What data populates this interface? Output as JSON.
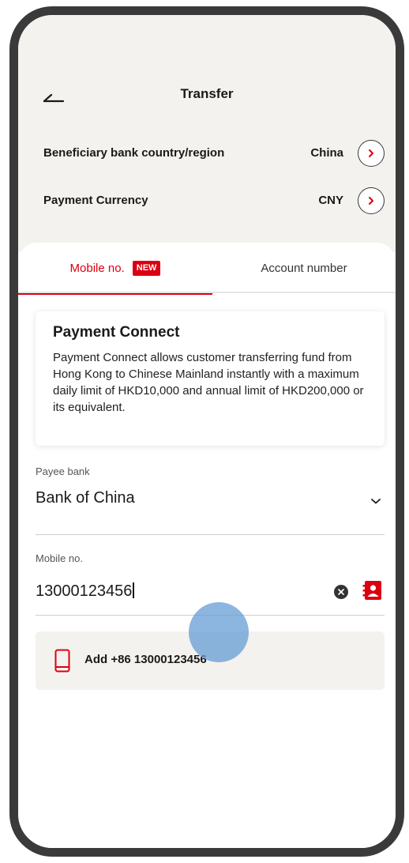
{
  "header": {
    "title": "Transfer"
  },
  "settings": [
    {
      "label": "Beneficiary bank country/region",
      "value": "China"
    },
    {
      "label": "Payment Currency",
      "value": "CNY"
    }
  ],
  "tabs": [
    {
      "label": "Mobile no.",
      "badge": "NEW",
      "active": true
    },
    {
      "label": "Account number",
      "active": false
    }
  ],
  "info_card": {
    "title": "Payment Connect",
    "text": "Payment Connect allows customer transferring fund from Hong Kong to Chinese Mainland instantly with a maximum daily limit of HKD10,000 and annual limit of HKD200,000 or its equivalent."
  },
  "payee_bank": {
    "label": "Payee bank",
    "value": "Bank of China"
  },
  "mobile": {
    "label": "Mobile no.",
    "value": "13000123456"
  },
  "suggestion": {
    "text": "Add +86 13000123456"
  },
  "colors": {
    "accent": "#db0011",
    "background": "#f4f2ee",
    "touch": "#6099d4"
  }
}
